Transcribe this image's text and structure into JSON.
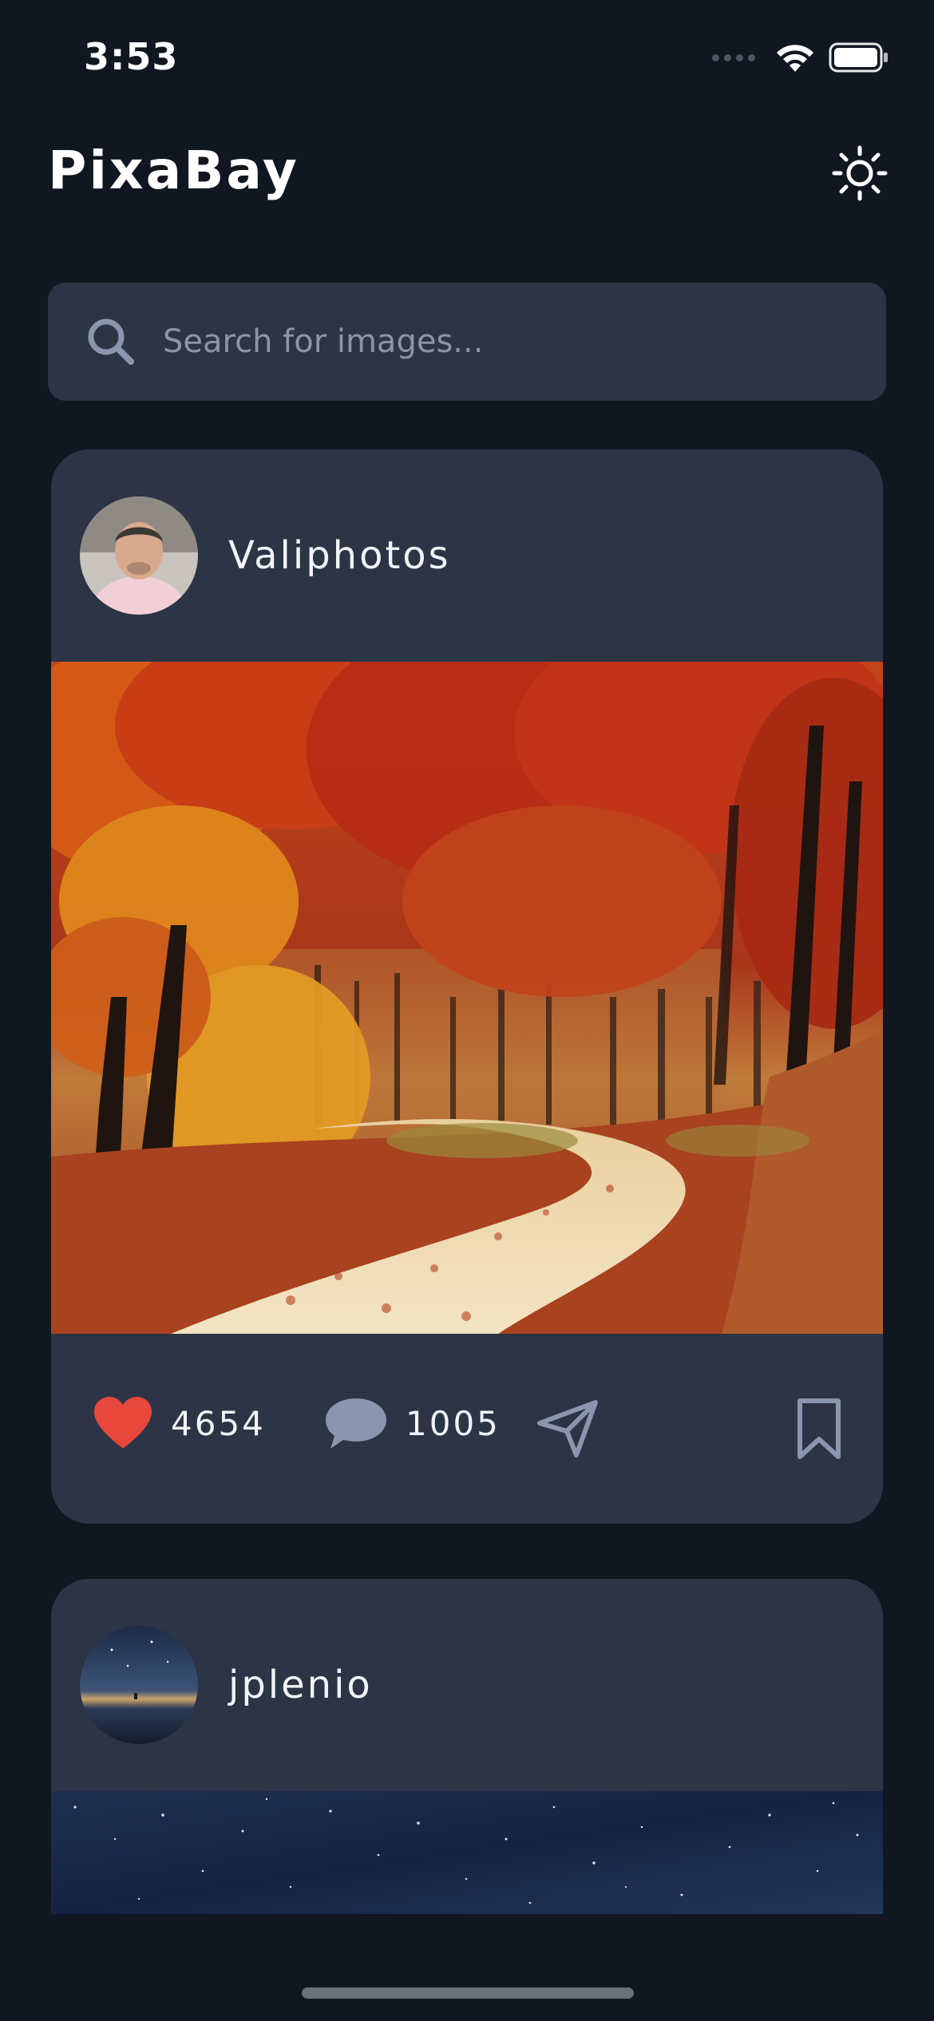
{
  "status_bar": {
    "time": "3:53",
    "icons": [
      "cellular-signal-icon",
      "wifi-icon",
      "battery-icon"
    ]
  },
  "header": {
    "title": "PixaBay",
    "theme_toggle_icon": "sun-icon"
  },
  "search": {
    "placeholder": "Search for images...",
    "value": "",
    "icon": "search-icon"
  },
  "feed": [
    {
      "author": "Valiphotos",
      "avatar_icon": "avatar",
      "photo": "autumn-forest-path",
      "likes": "4654",
      "comments": "1005",
      "like_icon": "heart-icon",
      "comment_icon": "comment-icon",
      "share_icon": "send-icon",
      "bookmark_icon": "bookmark-icon"
    },
    {
      "author": "jplenio",
      "avatar_icon": "avatar",
      "photo": "starry-night-sky"
    }
  ],
  "colors": {
    "background": "#111721",
    "surface": "#2c3445",
    "like": "#e8473c",
    "icon_muted": "#8a96ad",
    "text": "#f2f4f8",
    "placeholder": "#8d95a5"
  }
}
